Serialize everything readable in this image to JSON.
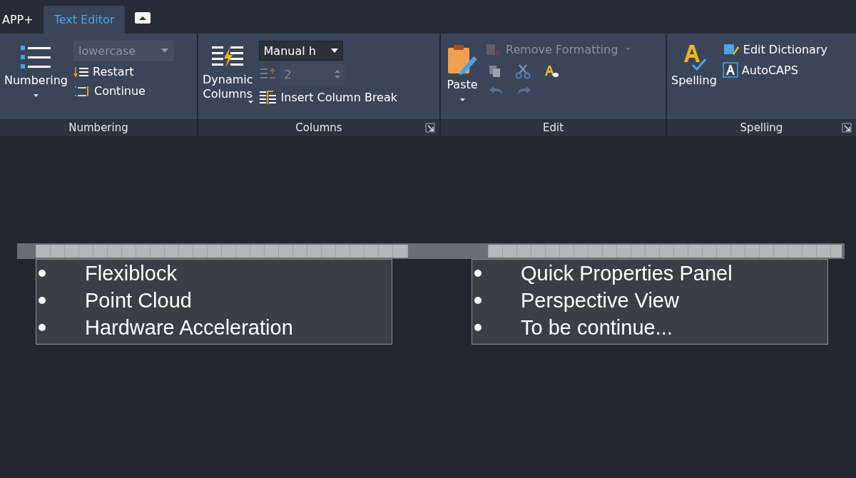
{
  "app_menu": "APP+",
  "tabs": [
    {
      "label": "Text Editor",
      "selected": true
    }
  ],
  "numbering": {
    "title": "Numbering",
    "button": "Numbering",
    "format": {
      "value": "lowercase",
      "disabled": true
    },
    "restart": "Restart",
    "continue": "Continue"
  },
  "columns": {
    "title": "Columns",
    "button": [
      "Dynamic",
      "Columns"
    ],
    "height": {
      "value": "Manual h",
      "disabled": false
    },
    "count": {
      "value": "2",
      "disabled": true
    },
    "insert_break": "Insert Column Break"
  },
  "edit": {
    "title": "Edit",
    "paste": "Paste",
    "remove_formatting": {
      "label": "Remove Formatting",
      "disabled": true
    }
  },
  "spelling": {
    "title": "Spelling",
    "button": "Spelling",
    "edit_dictionary": "Edit Dictionary",
    "autocaps": "AutoCAPS"
  },
  "text_columns": [
    {
      "items": [
        "Flexiblock",
        "Point Cloud",
        "Hardware Acceleration"
      ]
    },
    {
      "items": [
        "Quick Properties Panel",
        "Perspective View",
        "To be continue..."
      ]
    }
  ]
}
